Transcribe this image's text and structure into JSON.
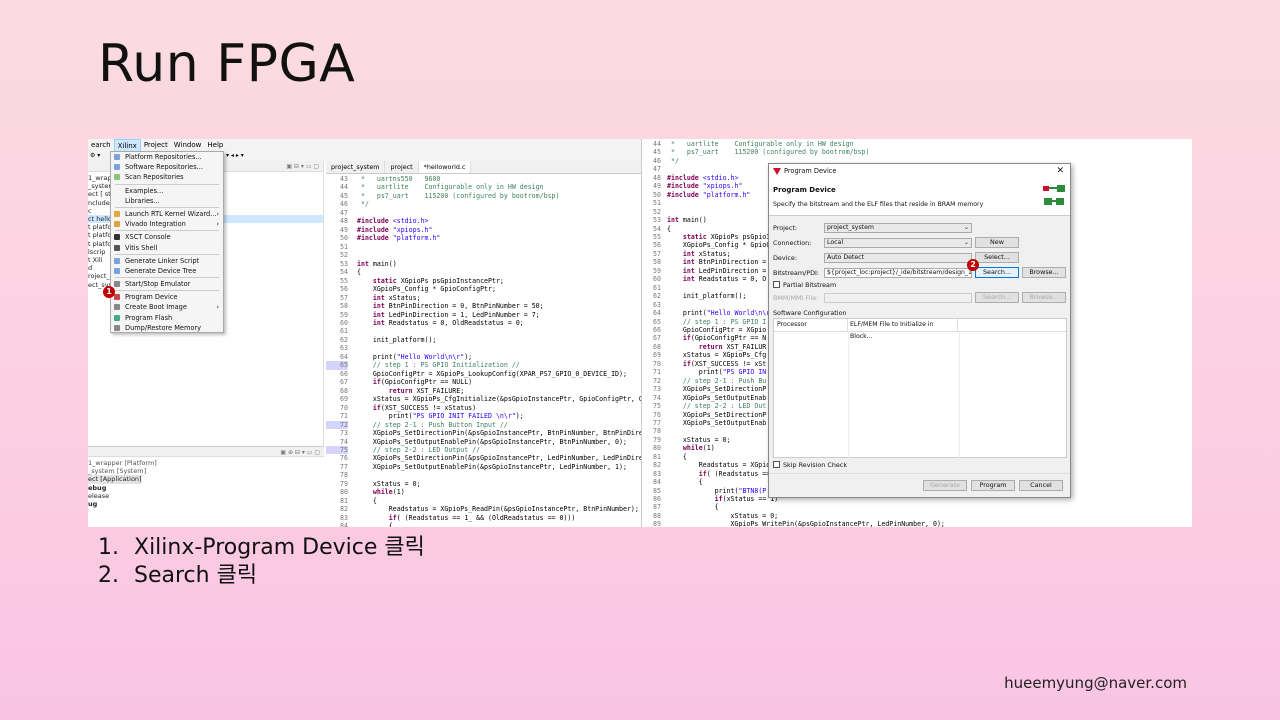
{
  "slide": {
    "title": "Run FPGA",
    "steps": [
      "Xilinx-Program Device 클릭",
      "Search 클릭"
    ],
    "step_numbers": [
      "1.",
      "2."
    ],
    "email": "hueemyung@naver.com"
  },
  "ide": {
    "menubar": [
      "earch",
      "Xilinx",
      "Project",
      "Window",
      "Help"
    ],
    "tree_items": [
      "1_wrap",
      "_system",
      "ect [ st",
      "ncludes",
      "c",
      "ct hello",
      "t platfc",
      "t platfc",
      "t platfc",
      "lscrip",
      "t Xili",
      "d",
      "roject_s",
      "ect_sys"
    ],
    "bottom_items": [
      "1_wrapper [Platform]",
      "_system [System]",
      "ect [Application]",
      "ebug",
      "elease",
      "ug"
    ],
    "context_menu": [
      {
        "label": "Platform Repositories...",
        "icon": "repo-icon"
      },
      {
        "label": "Software Repositories...",
        "icon": "repo-icon"
      },
      {
        "label": "Scan Repositories",
        "icon": "scan-icon"
      },
      {
        "label": "Examples...",
        "icon": ""
      },
      {
        "label": "Libraries...",
        "icon": ""
      },
      {
        "label": "Launch RTL Kernel Wizard...",
        "icon": "wizard-icon",
        "submenu": true
      },
      {
        "label": "Vivado Integration",
        "icon": "vivado-icon",
        "submenu": true
      },
      {
        "label": "XSCT Console",
        "icon": "console-icon"
      },
      {
        "label": "Vitis Shell",
        "icon": "shell-icon"
      },
      {
        "label": "Generate Linker Script",
        "icon": "linker-icon"
      },
      {
        "label": "Generate Device Tree",
        "icon": "tree-icon"
      },
      {
        "label": "Start/Stop Emulator",
        "icon": "emulator-icon"
      },
      {
        "label": "Program Device",
        "icon": "program-icon"
      },
      {
        "label": "Create Boot Image",
        "icon": "boot-icon",
        "submenu": true
      },
      {
        "label": "Program Flash",
        "icon": "flash-icon"
      },
      {
        "label": "Dump/Restore Memory",
        "icon": "memory-icon"
      }
    ],
    "tabs": [
      "project_system",
      "project",
      "*helloworld.c"
    ],
    "badge1": "1",
    "badge2": "2"
  },
  "dialog": {
    "title": "Program Device",
    "heading": "Program Device",
    "description": "Specify the bitstream and the ELF files that reside in BRAM memory",
    "project_label": "Project:",
    "project_value": "project_system",
    "connection_label": "Connection:",
    "connection_value": "Local",
    "new_button": "New",
    "device_label": "Device:",
    "device_value": "Auto Detect",
    "select_button": "Select...",
    "bitstream_label": "Bitstream/PDI:",
    "bitstream_value": "${project_loc:project}/_ide/bitstream/design_1_",
    "search_button": "Search...",
    "browse_button": "Browse...",
    "partial_label": "Partial Bitstream",
    "bmm_label": "BMM/MMI File:",
    "search_button2": "Search...",
    "browse_button2": "Browse...",
    "sw_config_label": "Software Configuration",
    "col_processor": "Processor",
    "col_elf": "ELF/MEM File to Initialize in Block...",
    "skip_label": "Skip Revision Check",
    "generate_button": "Generate",
    "program_button": "Program",
    "cancel_button": "Cancel"
  }
}
